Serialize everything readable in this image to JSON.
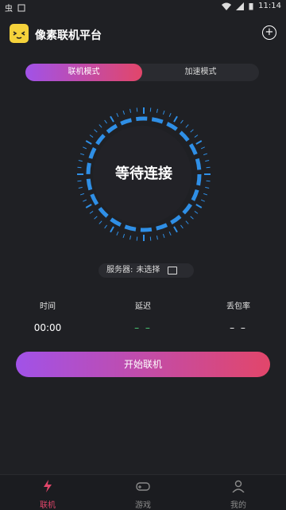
{
  "status_bar": {
    "left_label": "虫",
    "time": "11:14"
  },
  "app": {
    "title": "像素联机平台"
  },
  "mode_tabs": [
    {
      "label": "联机模式",
      "active": true
    },
    {
      "label": "加速模式",
      "active": false
    }
  ],
  "center": {
    "status": "等待连接"
  },
  "server": {
    "label": "服务器:",
    "value": "未选择"
  },
  "stats": [
    {
      "label": "时间",
      "value": "00:00"
    },
    {
      "label": "延迟",
      "value": "– –"
    },
    {
      "label": "丢包率",
      "value": "– –"
    }
  ],
  "start_button": {
    "label": "开始联机"
  },
  "bottom_nav": [
    {
      "label": "联机",
      "active": true
    },
    {
      "label": "游戏",
      "active": false
    },
    {
      "label": "我的",
      "active": false
    }
  ],
  "colors": {
    "accent_start": "#a152e8",
    "accent_end": "#e2466a",
    "dial": "#1f9bef",
    "delay_text": "#4ed67a"
  }
}
